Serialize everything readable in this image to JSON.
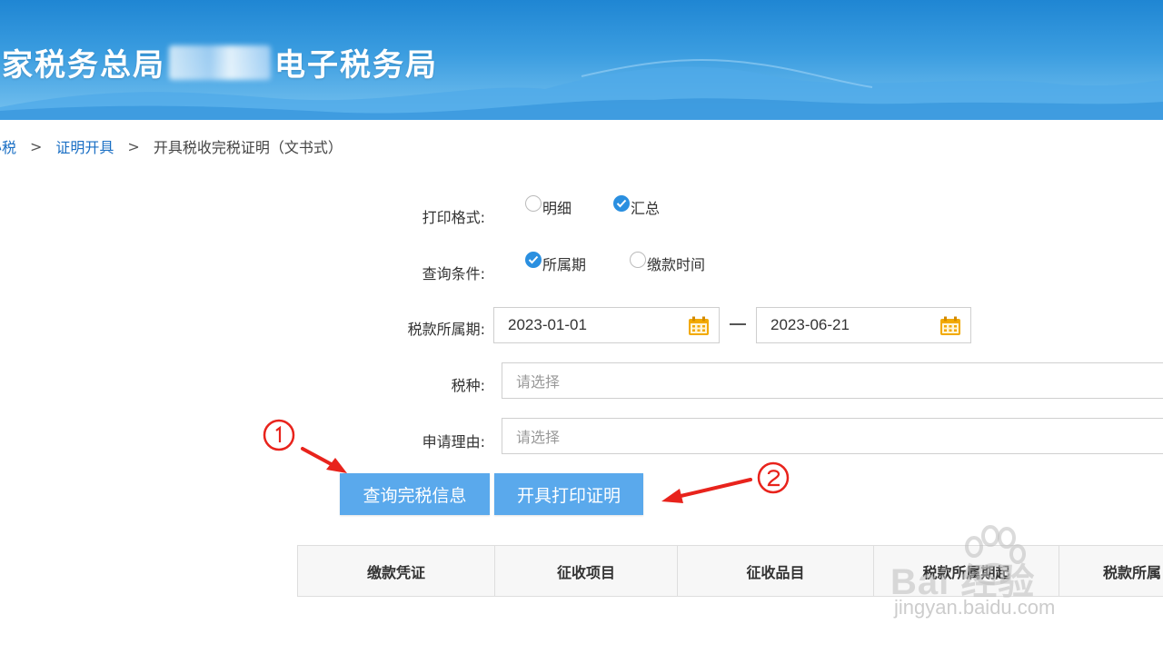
{
  "header": {
    "title_prefix": "家税务总局",
    "title_suffix": "电子税务局"
  },
  "breadcrumb": {
    "first": "办税",
    "second": "证明开具",
    "current": "开具税收完税证明（文书式）",
    "separator": ">"
  },
  "form": {
    "print_format": {
      "label": "打印格式:",
      "options": [
        {
          "label": "明细",
          "checked": false
        },
        {
          "label": "汇总",
          "checked": true
        }
      ]
    },
    "query_condition": {
      "label": "查询条件:",
      "options": [
        {
          "label": "所属期",
          "checked": true
        },
        {
          "label": "缴款时间",
          "checked": false
        }
      ]
    },
    "tax_period": {
      "label": "税款所属期:",
      "start": "2023-01-01",
      "end": "2023-06-21"
    },
    "tax_type": {
      "label": "税种:",
      "placeholder": "请选择"
    },
    "reason": {
      "label": "申请理由:",
      "placeholder": "请选择"
    }
  },
  "buttons": {
    "query": "查询完税信息",
    "print": "开具打印证明"
  },
  "annotations": {
    "step1": "①",
    "step2": "②",
    "arrow_color": "#e8231c"
  },
  "table": {
    "headers": [
      "缴款凭证",
      "征收项目",
      "征收品目",
      "税款所属期起",
      "税款所属"
    ]
  },
  "watermark": {
    "brand": "Bai 经验",
    "url": "jingyan.baidu.com"
  },
  "colors": {
    "accent": "#2a8fe0",
    "button": "#5aa9ec",
    "link": "#1a6fc4",
    "calendar_icon": "#f2a900"
  }
}
